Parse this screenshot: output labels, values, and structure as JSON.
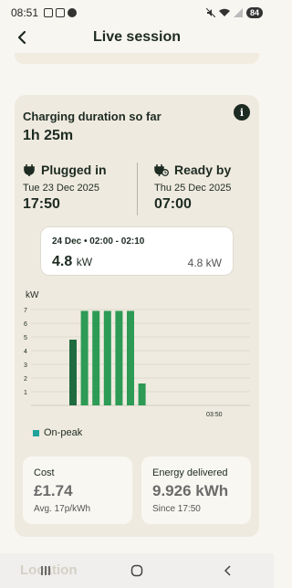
{
  "status_bar": {
    "time": "08:51",
    "battery": "84"
  },
  "header": {
    "title": "Live session"
  },
  "session": {
    "duration_label": "Charging duration so far",
    "duration_value": "1h 25m",
    "plugged_in": {
      "label": "Plugged in",
      "date": "Tue 23 Dec 2025",
      "time": "17:50"
    },
    "ready_by": {
      "label": "Ready by",
      "date": "Thu 25 Dec 2025",
      "time": "07:00"
    }
  },
  "tooltip": {
    "label": "24 Dec • 02:00 - 02:10",
    "value": "4.8",
    "unit": "kW",
    "right_value": "4.8 kW"
  },
  "chart_data": {
    "type": "bar",
    "ylabel": "kW",
    "ylim": [
      0,
      7
    ],
    "yticks": [
      "1",
      "2",
      "3",
      "4",
      "5",
      "6",
      "7"
    ],
    "x_tick_label": "03:50",
    "values": [
      4.8,
      6.9,
      6.9,
      6.9,
      6.9,
      6.9,
      1.6
    ],
    "colors": [
      "#1e6b3f",
      "#2d9a55",
      "#2d9a55",
      "#2d9a55",
      "#2d9a55",
      "#2d9a55",
      "#2d9a55"
    ],
    "legend": [
      {
        "name": "On-peak",
        "color": "#21a39a"
      }
    ]
  },
  "stats": {
    "cost": {
      "label": "Cost",
      "value": "£1.74",
      "sub": "Avg. 17p/kWh"
    },
    "energy": {
      "label": "Energy delivered",
      "value": "9.926 kWh",
      "sub": "Since 17:50"
    }
  },
  "navbar": {
    "ghost_text": "Location"
  },
  "icons": {
    "back": "back-arrow-icon",
    "info": "info-icon",
    "plug": "plug-icon",
    "ready": "plug-clock-icon",
    "recents": "recents-icon",
    "home": "home-icon",
    "nav_back": "nav-back-icon"
  }
}
